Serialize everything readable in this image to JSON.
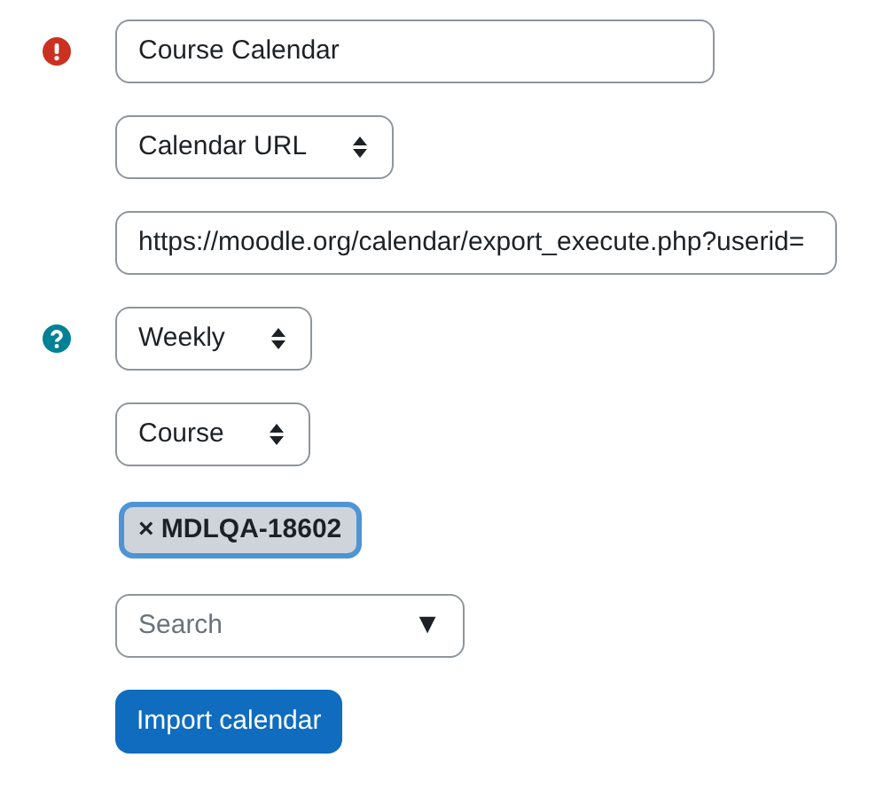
{
  "form": [
    {
      "kind": "text",
      "marker": {
        "kind": "error"
      },
      "value": "Course Calendar"
    },
    {
      "kind": "select",
      "value": "Calendar URL"
    },
    {
      "kind": "url",
      "value": "https://moodle.org/calendar/export_execute.php?userid="
    },
    {
      "kind": "select",
      "marker": {
        "kind": "help"
      },
      "value": "Weekly"
    },
    {
      "kind": "select",
      "value": "Course"
    },
    {
      "kind": "tag",
      "value": "× MDLQA-18602"
    },
    {
      "kind": "search",
      "placeholder": "Search",
      "toggle": "▼"
    },
    {
      "kind": "button",
      "value": "Import calendar"
    }
  ]
}
